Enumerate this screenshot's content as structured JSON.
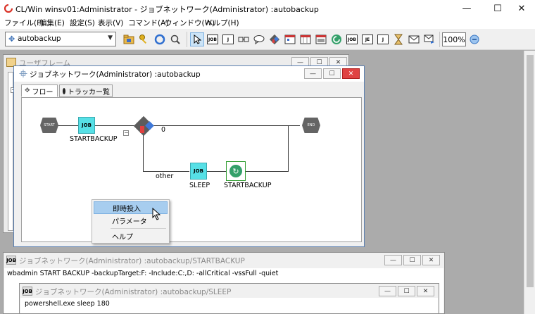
{
  "app": {
    "title": "CL/Win winsv01:Administrator - ジョブネットワーク(Administrator) :autobackup",
    "win_controls": {
      "minimize": "—",
      "maximize": "☐",
      "close": "✕"
    }
  },
  "menu": [
    "ファイル(F)",
    "編集(E)",
    "設定(S)",
    "表示(V)",
    "コマンド(A)",
    "ウィンドウ(W)",
    "ヘルプ(H)"
  ],
  "toolbar": {
    "combo_value": "autobackup",
    "zoom": "100%",
    "icons": [
      "folder-icon",
      "key-icon",
      "refresh-icon",
      "search-icon",
      "pointer-icon",
      "job-icon",
      "job-edit-icon",
      "link-icon",
      "comment-icon",
      "branch-icon",
      "calendar-icon",
      "calendar-grid-icon",
      "submit-icon",
      "job-small-icon",
      "job-small2-icon",
      "hourglass-icon",
      "mail-icon",
      "mail-send-icon"
    ]
  },
  "user_frame": {
    "title": "ユーザフレーム"
  },
  "job_window": {
    "title": "ジョブネットワーク(Administrator) :autobackup",
    "tabs": [
      "フロー",
      "トラッカー覧"
    ],
    "flow": {
      "start_label": "START",
      "end_label": "END",
      "job1": {
        "icon_text": "JOB",
        "label": "STARTBACKUP"
      },
      "branch_zero": "0",
      "branch_other": "other",
      "job2": {
        "icon_text": "JOB",
        "label": "SLEEP"
      },
      "job3": {
        "label": "STARTBACKUP"
      },
      "collapse": "−"
    }
  },
  "context_menu": {
    "items": [
      "即時投入",
      "パラメータ",
      "ヘルプ"
    ],
    "highlighted": 0
  },
  "win2": {
    "title": "ジョブネットワーク(Administrator) :autobackup/STARTBACKUP",
    "command": "wbadmin START BACKUP -backupTarget:F: -Include:C:,D: -allCritical -vssFull -quiet"
  },
  "win3": {
    "title": "ジョブネットワーク(Administrator) :autobackup/SLEEP",
    "command": "powershell.exe sleep 180"
  }
}
